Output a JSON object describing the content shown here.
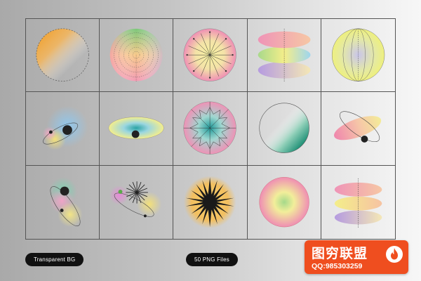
{
  "labels": {
    "transparent_bg": "Transparent BG",
    "png_files": "50 PNG Files"
  },
  "watermark": {
    "title": "图穷联盟",
    "qq": "QQ:985303259",
    "icon": "flame-icon",
    "color": "#ef4e1f"
  },
  "colors": {
    "grid_line": "#555555",
    "pill_bg": "#111111",
    "orbit_dot": "#222222"
  },
  "items": [
    {
      "name": "dashed-circle-orange-gradient"
    },
    {
      "name": "concentric-dotted-rainbow-sphere"
    },
    {
      "name": "pink-radial-compass-sphere"
    },
    {
      "name": "stacked-rainbow-discs"
    },
    {
      "name": "yellow-meridian-globe"
    },
    {
      "name": "blue-orbit-blur"
    },
    {
      "name": "yellow-ellipse-teal-eye"
    },
    {
      "name": "zigzag-radial-sphere"
    },
    {
      "name": "green-gradient-circle"
    },
    {
      "name": "tilted-pink-disc-orbit"
    },
    {
      "name": "green-orbit-blur"
    },
    {
      "name": "starburst-orbit"
    },
    {
      "name": "black-starburst-sun"
    },
    {
      "name": "pink-radial-orb"
    },
    {
      "name": "stacked-rainbow-discs-small"
    }
  ]
}
